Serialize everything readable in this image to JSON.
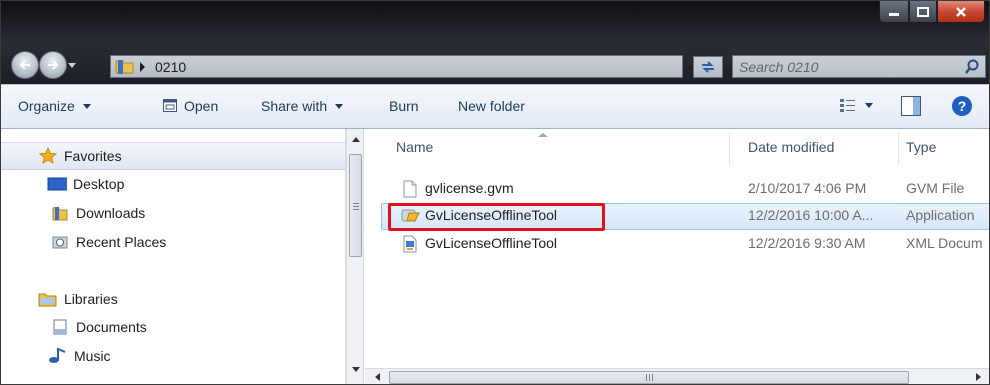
{
  "window": {
    "controls": {
      "minimize_icon": "minimize-icon",
      "maximize_icon": "maximize-icon",
      "close_icon": "close-icon",
      "close_color": "#c8432c"
    }
  },
  "address_bar": {
    "path": "0210",
    "search_placeholder": "Search 0210"
  },
  "toolbar": {
    "organize": "Organize",
    "open": "Open",
    "share_with": "Share with",
    "burn": "Burn",
    "new_folder": "New folder"
  },
  "nav_pane": {
    "favorites": "Favorites",
    "desktop": "Desktop",
    "downloads": "Downloads",
    "recent_places": "Recent Places",
    "libraries": "Libraries",
    "documents": "Documents",
    "music": "Music"
  },
  "file_list": {
    "columns": {
      "name": "Name",
      "date": "Date modified",
      "type": "Type"
    },
    "rows": [
      {
        "name": "gvlicense.gvm",
        "date": "2/10/2017 4:06 PM",
        "type": "GVM File",
        "icon": "blank-file-icon"
      },
      {
        "name": "GvLicenseOfflineTool",
        "date": "12/2/2016 10:00 A...",
        "type": "Application",
        "icon": "application-icon",
        "selected": true
      },
      {
        "name": "GvLicenseOfflineTool",
        "date": "12/2/2016 9:30 AM",
        "type": "XML Docum",
        "icon": "xml-document-icon"
      }
    ],
    "highlight_color": "#e2111b"
  }
}
